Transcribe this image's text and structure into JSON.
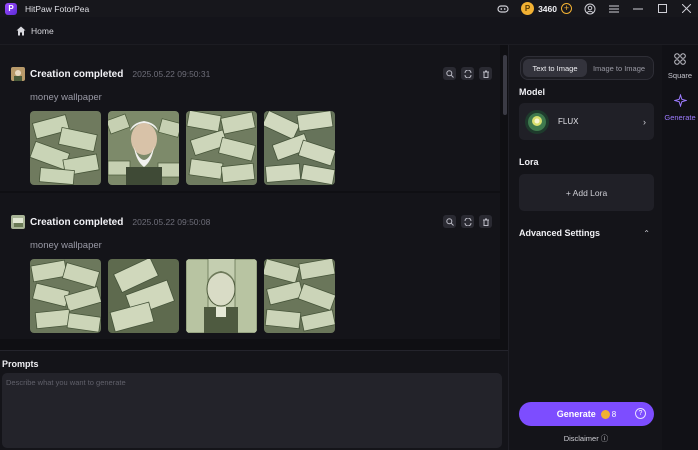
{
  "titlebar": {
    "app_title": "HitPaw FotorPea",
    "credits": "3460",
    "icons": [
      "discord-icon",
      "coin-icon",
      "plus-icon",
      "user-icon",
      "menu-icon",
      "minimize-icon",
      "maximize-icon",
      "close-icon"
    ]
  },
  "nav": {
    "home_label": "Home"
  },
  "feed": {
    "cards": [
      {
        "title": "Creation completed",
        "time": "2025.05.22  09:50:31",
        "prompt": "money wallpaper"
      },
      {
        "title": "Creation completed",
        "time": "2025.05.22  09:50:08",
        "prompt": "money wallpaper"
      }
    ]
  },
  "prompts": {
    "title": "Prompts",
    "placeholder": "Describe what you want to generate"
  },
  "panel": {
    "tabs": [
      "Text to Image",
      "Image to Image"
    ],
    "model_title": "Model",
    "model_name": "FLUX",
    "lora_title": "Lora",
    "add_lora": "+ Add Lora",
    "advanced_title": "Advanced Settings",
    "generate_label": "Generate",
    "generate_cost": "8",
    "disclaimer": "Disclaimer"
  },
  "sidenav": {
    "items": [
      "Square",
      "Generate"
    ]
  },
  "colors": {
    "accent": "#7d4dff",
    "coin": "#f2b133",
    "background": "#101014"
  }
}
